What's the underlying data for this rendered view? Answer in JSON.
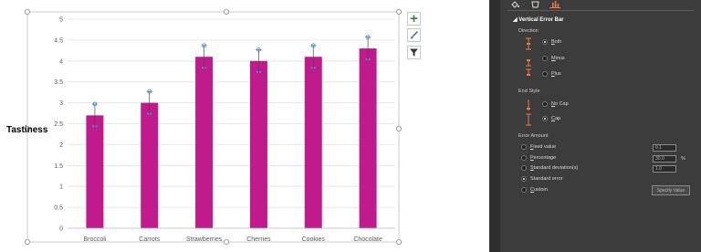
{
  "chart_data": {
    "type": "bar",
    "categories": [
      "Broccoli",
      "Carrots",
      "Strawberries",
      "Cherries",
      "Cookies",
      "Chocolate"
    ],
    "values": [
      2.7,
      3.0,
      4.1,
      4.0,
      4.1,
      4.3
    ],
    "error_bar_tops": [
      2.97,
      3.27,
      4.37,
      4.27,
      4.37,
      4.57
    ],
    "ylim": [
      0,
      5
    ],
    "yticks": [
      "0",
      "0.5",
      "1",
      "1.5",
      "2",
      "2.5",
      "3",
      "3.5",
      "4",
      "4.5",
      "5"
    ],
    "ylabel": "Tastiness",
    "xlabel": "",
    "title": "",
    "bar_color": "#c01a8c",
    "grid": true,
    "legend": "none"
  },
  "chart_side_buttons": {
    "add_element_icon": "plus-icon",
    "style_icon": "brush-icon",
    "filter_icon": "filter-icon"
  },
  "pane": {
    "tabs": [
      {
        "icon": "fill-bucket-icon"
      },
      {
        "icon": "pentagon-icon"
      },
      {
        "icon": "bar-chart-icon"
      }
    ],
    "section_title": "Vertical Error Bar",
    "direction": {
      "label": "Direction",
      "options": [
        {
          "label": "Both",
          "checked": true
        },
        {
          "label": "Minus",
          "checked": false
        },
        {
          "label": "Plus",
          "checked": false
        }
      ]
    },
    "end_style": {
      "label": "End Style",
      "options": [
        {
          "label": "No Cap",
          "checked": false
        },
        {
          "label": "Cap",
          "checked": true
        }
      ]
    },
    "error_amount": {
      "label": "Error Amount",
      "options": [
        {
          "label": "Fixed value",
          "checked": false,
          "value": "0.1"
        },
        {
          "label": "Percentage",
          "checked": false,
          "value": "30.0",
          "unit": "%"
        },
        {
          "label": "Standard deviation(s)",
          "checked": false,
          "value": "1.0"
        },
        {
          "label": "Standard error",
          "checked": true
        },
        {
          "label": "Custom",
          "checked": false
        }
      ],
      "specify_value_label": "Specify Value"
    }
  },
  "colors": {
    "pane_bg": "#3c3c3c",
    "accent": "#f07b3f",
    "error_bar": "#4a90d9"
  }
}
